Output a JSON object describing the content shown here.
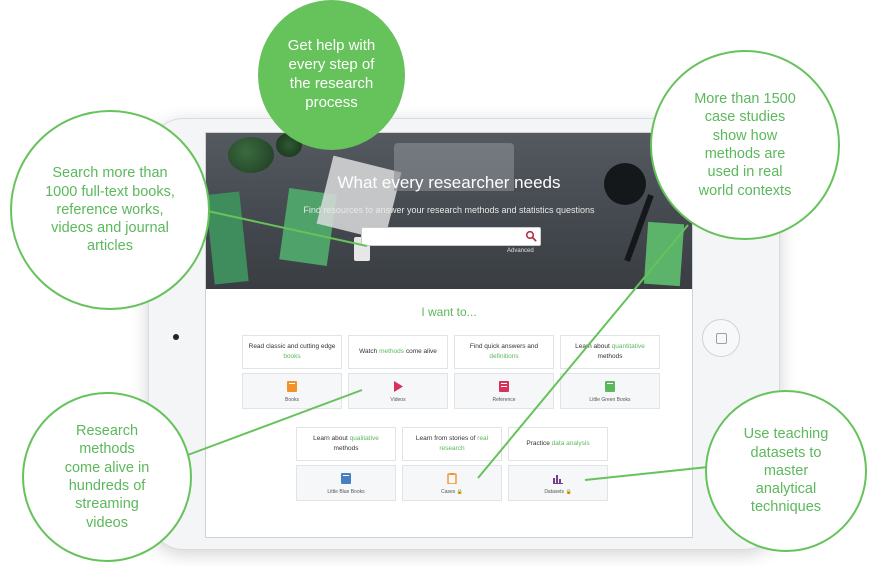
{
  "hero": {
    "title": "What every researcher needs",
    "subtitle": "Find resources to answer your research methods and statistics questions",
    "search_placeholder": "",
    "advanced_label": "Advanced"
  },
  "main": {
    "heading": "I want to...",
    "cards_row1": [
      {
        "pre": "Read classic and cutting edge ",
        "hl": "books",
        "post": "",
        "tile": "Books",
        "icon": "book-icon",
        "color": "#f0932b"
      },
      {
        "pre": "Watch ",
        "hl": "methods",
        "post": " come alive",
        "tile": "Videos",
        "icon": "play-icon",
        "color": "#d8315b"
      },
      {
        "pre": "Find quick answers and ",
        "hl": "definitions",
        "post": "",
        "tile": "Reference",
        "icon": "reference-icon",
        "color": "#d8315b"
      },
      {
        "pre": "Learn about ",
        "hl": "quantitative",
        "post": " methods",
        "tile": "Little Green Books",
        "icon": "green-book-icon",
        "color": "#5cb85c"
      }
    ],
    "cards_row2": [
      {
        "pre": "Learn about ",
        "hl": "qualitative",
        "post": " methods",
        "tile": "Little Blue Books",
        "icon": "blue-book-icon",
        "color": "#4a7fc1"
      },
      {
        "pre": "Learn from stories of ",
        "hl": "real research",
        "post": "",
        "tile": "Cases",
        "icon": "case-icon",
        "color": "#f0932b"
      },
      {
        "pre": "Practice ",
        "hl": "data analysis",
        "post": "",
        "tile": "Datasets",
        "icon": "dataset-icon",
        "color": "#7a3c8c"
      }
    ]
  },
  "callouts": {
    "top": "Get help with every step of the research process",
    "left_top": "Search more than 1000 full-text books, reference works, videos and journal articles",
    "right_top": "More than 1500 case studies show how methods are used in real world contexts",
    "left_bottom": "Research methods come alive in hundreds of streaming videos",
    "right_bottom": "Use teaching datasets to master analytical techniques"
  },
  "colors": {
    "accent": "#5cb85c",
    "callout_border": "#66c25b",
    "hero_bg": "#4a4f55"
  }
}
